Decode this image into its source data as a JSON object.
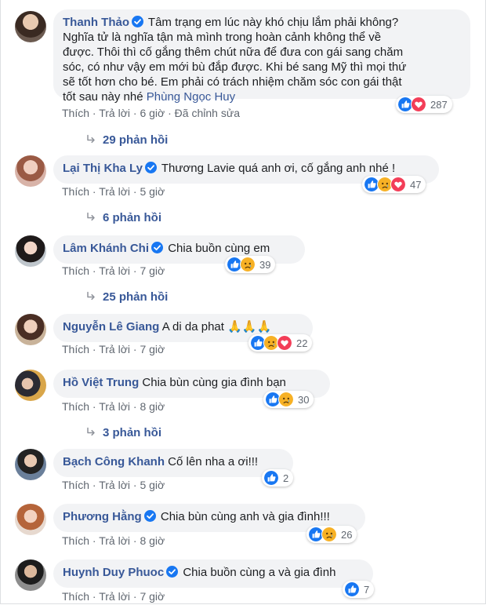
{
  "comments": [
    {
      "name": "Thanh Thảo",
      "verified": true,
      "text_lines": [
        "Tâm trạng em lúc này khó chịu lắm phải không?",
        "Nghĩa tử là nghĩa tận mà mình trong hoàn cảnh không thể về",
        "được. Thôi thì cố gắng thêm chút nữa để đưa con gái sang chăm",
        "sóc, có như vậy em mới bù đắp được. Khi bé sang Mỹ thì mọi thứ",
        "sẽ tốt hơn cho bé. Em phải có trách nhiệm chăm sóc con gái thật"
      ],
      "last_line_text": "tốt sau này nhé ",
      "tag": "Phùng Ngọc Huy",
      "like": "Thích",
      "reply": "Trả lời",
      "time": "6 giờ",
      "edited": "Đã chỉnh sửa",
      "reactions": [
        "like",
        "love"
      ],
      "reaction_count": "287",
      "replies": "29 phản hồi"
    },
    {
      "name": "Lại Thị Kha Ly",
      "verified": true,
      "text": "Thương Lavie quá anh ơi, cố gắng anh nhé !",
      "like": "Thích",
      "reply": "Trả lời",
      "time": "5 giờ",
      "reactions": [
        "like",
        "sad",
        "love"
      ],
      "reaction_count": "47",
      "replies": "6 phản hồi"
    },
    {
      "name": "Lâm Khánh Chi",
      "verified": true,
      "text": "Chia buồn cùng em",
      "like": "Thích",
      "reply": "Trả lời",
      "time": "7 giờ",
      "reactions": [
        "like",
        "sad"
      ],
      "reaction_count": "39",
      "replies": "25 phản hồi"
    },
    {
      "name": "Nguyễn Lê Giang",
      "verified": false,
      "text": "A di da phat 🙏🙏🙏",
      "like": "Thích",
      "reply": "Trả lời",
      "time": "7 giờ",
      "reactions": [
        "like",
        "sad",
        "love"
      ],
      "reaction_count": "22"
    },
    {
      "name": "Hồ Việt Trung",
      "verified": false,
      "text": "Chia bùn cùng gia đình bạn",
      "like": "Thích",
      "reply": "Trả lời",
      "time": "8 giờ",
      "reactions": [
        "like",
        "sad"
      ],
      "reaction_count": "30",
      "replies": "3 phản hồi"
    },
    {
      "name": "Bạch Công Khanh",
      "verified": false,
      "text": "Cố lên nha a ơi!!!",
      "like": "Thích",
      "reply": "Trả lời",
      "time": "5 giờ",
      "reactions": [
        "like"
      ],
      "reaction_count": "2"
    },
    {
      "name": "Phương Hằng",
      "verified": true,
      "text": "Chia bùn cùng anh và gia đình!!!",
      "like": "Thích",
      "reply": "Trả lời",
      "time": "8 giờ",
      "reactions": [
        "like",
        "sad"
      ],
      "reaction_count": "26"
    },
    {
      "name": "Huynh Duy Phuoc",
      "verified": true,
      "text": "Chia buồn cùng a và gia đình",
      "like": "Thích",
      "reply": "Trả lời",
      "time": "7 giờ",
      "reactions": [
        "like"
      ],
      "reaction_count": "7"
    }
  ],
  "colors": {
    "name": "#385898",
    "bubble": "#f2f3f5",
    "meta": "#606770",
    "like": "#1877f2",
    "love": "#f33e58",
    "sad": "#f7b125"
  },
  "icons": {
    "verified": "verified-badge-icon",
    "reply_arrow": "reply-arrow-icon",
    "like": "like-reaction-icon",
    "love": "love-reaction-icon",
    "sad": "sad-reaction-icon"
  }
}
